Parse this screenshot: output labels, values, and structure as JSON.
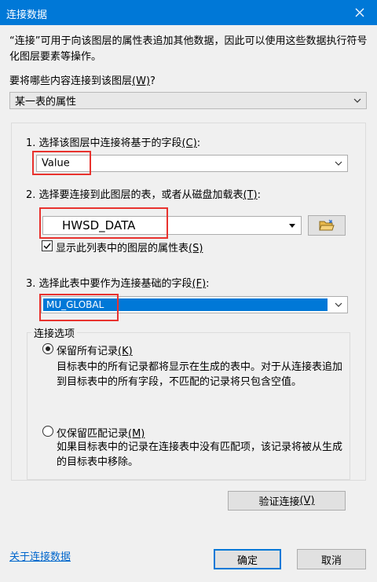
{
  "window": {
    "title": "连接数据",
    "close_icon": "close-icon"
  },
  "intro": "“连接”可用于向该图层的属性表追加其他数据，因此可以使用这些数据执行符号化图层要素等操作。",
  "join_type": {
    "label": "要将哪些内容连接到该图层",
    "hotkey": "(W)",
    "suffix": "?",
    "value": "某一表的属性"
  },
  "step1": {
    "label": "1. 选择该图层中连接将基于的字段",
    "hotkey": "(C)",
    "suffix": ":",
    "value": "Value"
  },
  "step2": {
    "label": "2. 选择要连接到此图层的表，或者从磁盘加载表",
    "hotkey": "(T)",
    "suffix": ":",
    "value": "HWSD_DATA",
    "browse_icon": "folder-open-icon",
    "checkbox_label": "显示此列表中的图层的属性表",
    "checkbox_hotkey": "(S)",
    "checkbox_checked": true
  },
  "step3": {
    "label": "3. 选择此表中要作为连接基础的字段",
    "hotkey": "(F)",
    "suffix": ":",
    "value": "MU_GLOBAL"
  },
  "options": {
    "group_label": "连接选项",
    "keep_all": {
      "label": "保留所有记录",
      "hotkey": "(K)",
      "selected": true,
      "description": "目标表中的所有记录都将显示在生成的表中。对于从连接表追加到目标表中的所有字段，不匹配的记录将只包含空值。"
    },
    "keep_matching": {
      "label": "仅保留匹配记录",
      "hotkey": "(M)",
      "selected": false,
      "description": "如果目标表中的记录在连接表中没有匹配项，该记录将被从生成的目标表中移除。"
    }
  },
  "validate_button": {
    "label": "验证连接",
    "hotkey": "(V)"
  },
  "footer": {
    "about_link": "关于连接数据",
    "ok": "确定",
    "cancel": "取消"
  },
  "colors": {
    "title_bar": "#0078d7",
    "highlight": "#e8322e",
    "selection": "#0078d7"
  }
}
